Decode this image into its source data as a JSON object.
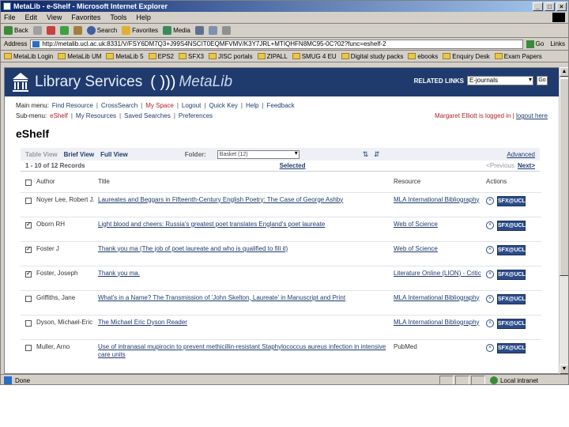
{
  "window": {
    "title": "MetaLib - e-Shelf - Microsoft Internet Explorer",
    "buttons": [
      "_",
      "□",
      "×"
    ]
  },
  "menubar": [
    "File",
    "Edit",
    "View",
    "Favorites",
    "Tools",
    "Help"
  ],
  "toolbar": {
    "back": "Back",
    "search": "Search",
    "favorites": "Favorites",
    "media": "Media"
  },
  "address": {
    "label": "Address",
    "url": "http://metalib.ucl.ac.uk:8331/V/FSY6DM7Q3+J99S4NSCIT0EQMFVMV/K3Y7JRL+MTIQHFN8MC95-0C?02?func=eshelf-2",
    "go": "Go",
    "links": "Links"
  },
  "links": [
    "MetaLib Login",
    "MetaLib UM",
    "MetaLib 5",
    "EPS2",
    "SFX3",
    "JISC portals",
    "ZIPALL",
    "SMUG 4 EU",
    "Digital study packs",
    "ebooks",
    "Enquiry Desk",
    "Exam Papers"
  ],
  "banner": {
    "brand": "Library Services",
    "parens": "( )))",
    "product": "MetaLib",
    "related_label": "RELATED LINKS",
    "related_value": "E-journals",
    "go": "Go"
  },
  "nav": {
    "main_label": "Main menu:",
    "main_items": [
      "Find Resource",
      "CrossSearch",
      "My Space",
      "Logout",
      "Quick Key",
      "Help",
      "Feedback"
    ],
    "main_active": "My Space",
    "sub_label": "Sub-menu:",
    "sub_items": [
      "eShelf",
      "My Resources",
      "Saved Searches",
      "Preferences"
    ],
    "sub_active": "eShelf",
    "user_text": "Margaret Elliott is logged in",
    "user_sep": " | ",
    "user_link": "logout here"
  },
  "page_title": "eShelf",
  "viewbar": {
    "table_view": "Table View",
    "brief_view": "Brief View",
    "full_view": "Full View",
    "folder_label": "Folder:",
    "folder_value": "Basket (12)",
    "sort_icons": "⇅ ⇵",
    "advanced": "Advanced"
  },
  "recbar": {
    "count": "1 - 10 of 12 Records",
    "selected": "Selected",
    "previous": "<Previous",
    "next": "Next>"
  },
  "columns": [
    "Author",
    "Title",
    "Resource",
    "Actions"
  ],
  "records": [
    {
      "checked": false,
      "author": "Noyer Lee, Robert J.",
      "title": "Laureates and Beggars in Fifteenth-Century English Poetry: The Case of George Ashby",
      "resource": "MLA International Bibliography",
      "resource_link": true
    },
    {
      "checked": true,
      "author": "Oborn RH",
      "title": "Light blood and cheers: Russia's greatest poet translates England's poet laureate",
      "resource": "Web of Science",
      "resource_link": true
    },
    {
      "checked": true,
      "author": "Foster J",
      "title": "Thank you ma (The job of poet laureate and who is qualified to fill it)",
      "resource": "Web of Science",
      "resource_link": true
    },
    {
      "checked": true,
      "author": "Foster, Joseph",
      "title": "Thank you ma.",
      "resource": "Literature Online (LION) - Critic",
      "resource_link": true
    },
    {
      "checked": false,
      "author": "Griffiths, Jane",
      "title": "What's in a Name? The Transmission of 'John Skelton, Laureate' in Manuscript and Print",
      "resource": "MLA International Bibliography",
      "resource_link": true
    },
    {
      "checked": false,
      "author": "Dyson, Michael-Eric",
      "title": "The Michael Eric Dyson Reader",
      "resource": "MLA International Bibliography",
      "resource_link": true
    },
    {
      "checked": false,
      "author": "Muller, Arno",
      "title": "Use of intranasal mupirocin to prevent methicillin-resistant Staphylococcus aureus infection in intensive care units",
      "resource": "PubMed",
      "resource_link": false
    }
  ],
  "action_sfx": "SFX@UCL",
  "action_delete": "×",
  "status": {
    "text": "Done",
    "zone": "Local intranet"
  },
  "colors": {
    "banner": "#1f3b6e",
    "link": "#1f3b6e",
    "active": "#b22222",
    "titlebar": "#0a246a"
  }
}
